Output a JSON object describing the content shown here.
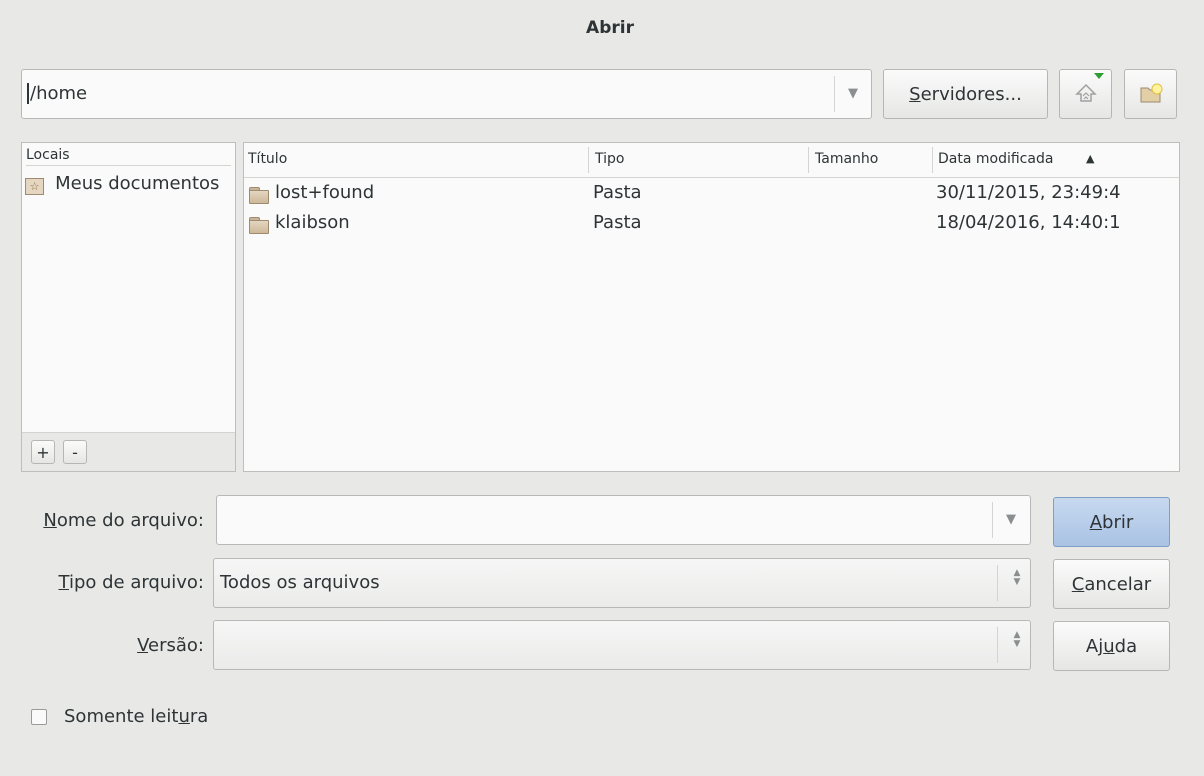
{
  "window": {
    "title": "Abrir"
  },
  "toolbar": {
    "path_value": "/home",
    "servers_label": "Servidores...",
    "servers_mnemonic_rest": "ervidores...",
    "servers_mnemonic": "S"
  },
  "places": {
    "header": "Locais",
    "items": [
      {
        "label": "Meus documentos",
        "icon": "bookmark-star-icon"
      }
    ],
    "add_label": "+",
    "remove_label": "-"
  },
  "files": {
    "columns": {
      "title": "Título",
      "type": "Tipo",
      "size": "Tamanho",
      "modified": "Data modificada"
    },
    "sort_indicator": "▲",
    "rows": [
      {
        "name": "lost+found",
        "type": "Pasta",
        "size": "",
        "modified": "30/11/2015, 23:49:4"
      },
      {
        "name": "klaibson",
        "type": "Pasta",
        "size": "",
        "modified": "18/04/2016, 14:40:1"
      }
    ]
  },
  "form": {
    "filename": {
      "label_m": "N",
      "label_rest": "ome do arquivo:",
      "value": ""
    },
    "filetype": {
      "label_m": "T",
      "label_rest": "ipo de arquivo:",
      "value": "Todos os arquivos"
    },
    "version": {
      "label_m": "V",
      "label_rest": "ersão:",
      "value": ""
    }
  },
  "buttons": {
    "open": {
      "m": "A",
      "rest": "brir"
    },
    "cancel": {
      "m": "C",
      "rest": "ancelar"
    },
    "help": {
      "pre": "Aj",
      "m": "u",
      "rest": "da"
    }
  },
  "readonly": {
    "pre": "Somente leit",
    "m": "u",
    "rest": "ra",
    "checked": false
  },
  "colors": {
    "accent": "#a9c3e4",
    "background": "#e8e8e7"
  }
}
